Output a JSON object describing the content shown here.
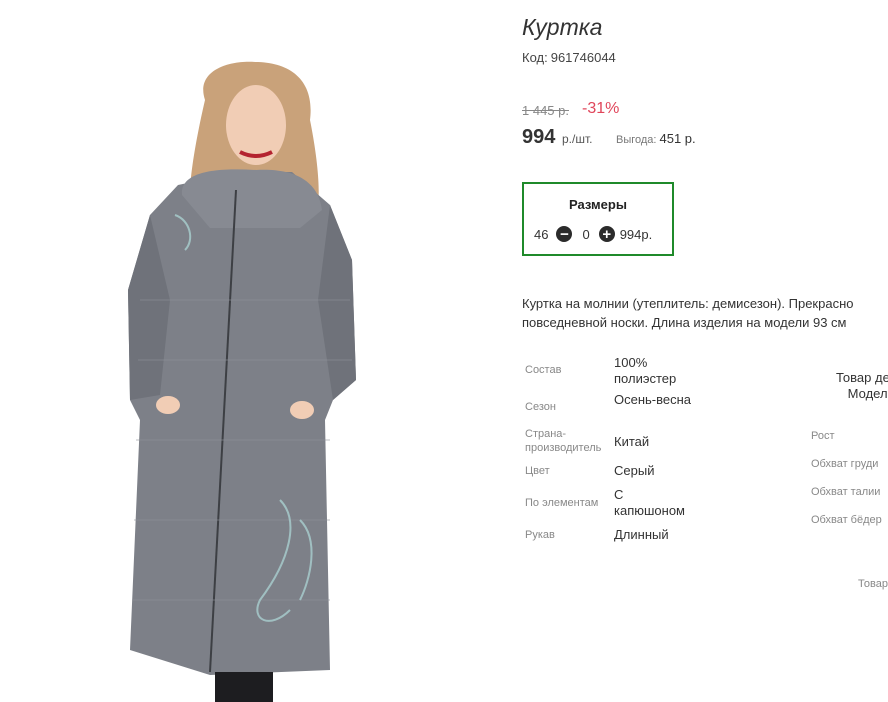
{
  "product": {
    "title": "Куртка",
    "code_label": "Код:",
    "code": "961746044",
    "old_price": "1 445 р.",
    "discount": "-31%",
    "price": "994",
    "price_unit": "р./шт.",
    "benefit_label": "Выгода:",
    "benefit_value": "451 р."
  },
  "sizes": {
    "title": "Размеры",
    "size": "46",
    "quantity": "0",
    "price": "994р."
  },
  "description": {
    "line1": "Куртка на молнии (утеплитель: демисезон). Прекрасно",
    "line2": "повседневной носки. Длина изделия на модели 93 см"
  },
  "attributes": [
    {
      "label": "Состав",
      "value": "100% полиэстер"
    },
    {
      "label": "Сезон",
      "value": "Осень-весна"
    },
    {
      "label": "Страна-производитель",
      "value": "Китай"
    },
    {
      "label": "Цвет",
      "value": "Серый"
    },
    {
      "label": "По элементам",
      "value": "С капюшоном"
    },
    {
      "label": "Рукав",
      "value": "Длинный"
    }
  ],
  "model_info": {
    "line1": "Товар демо",
    "line2": "Модель",
    "measures": [
      "Рост",
      "Обхват груди",
      "Обхват талии",
      "Обхват бёдер"
    ]
  },
  "footer_partial": "Товар",
  "colors": {
    "discount": "#e0455a",
    "sizes_border": "#1f8a2a",
    "coat": "#7d8088"
  }
}
